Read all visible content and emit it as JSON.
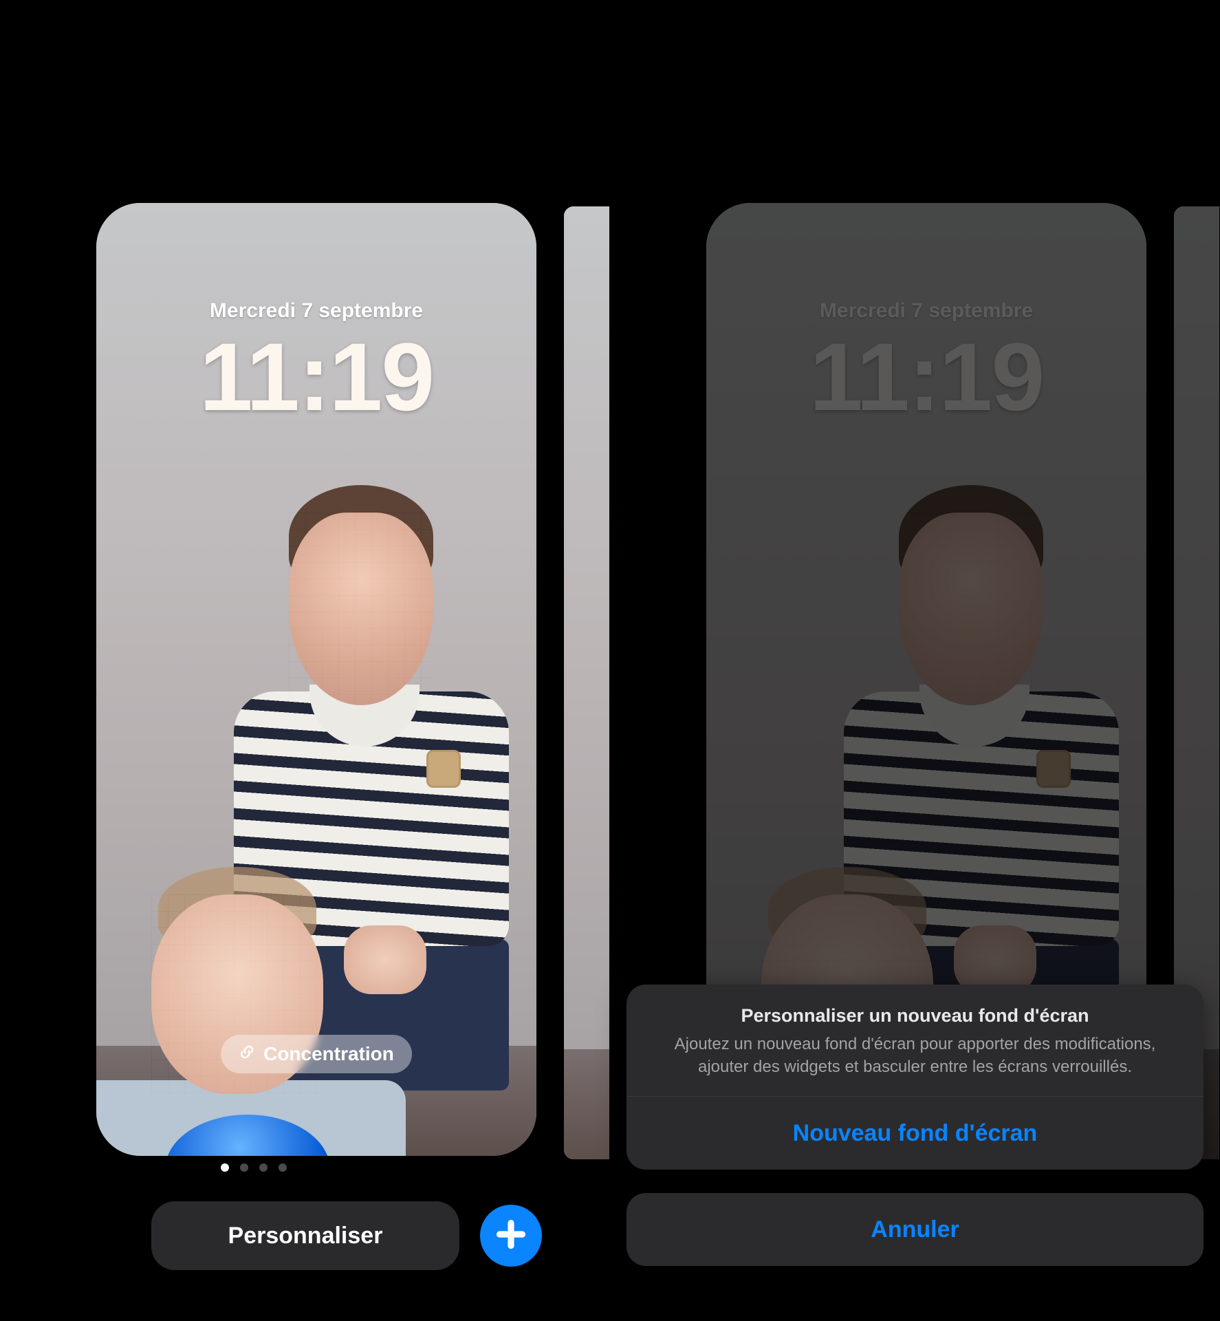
{
  "lockscreen": {
    "date": "Mercredi 7 septembre",
    "time": "11:19",
    "focus_label": "Concentration"
  },
  "pagination": {
    "count": 4,
    "active_index": 0
  },
  "buttons": {
    "customize": "Personnaliser"
  },
  "action_sheet": {
    "title": "Personnaliser un nouveau fond d'écran",
    "description": "Ajoutez un nouveau fond d'écran pour apporter des modifications, ajouter des widgets et basculer entre les écrans verrouillés.",
    "primary": "Nouveau fond d'écran",
    "cancel": "Annuler"
  },
  "colors": {
    "accent": "#0a84ff"
  }
}
